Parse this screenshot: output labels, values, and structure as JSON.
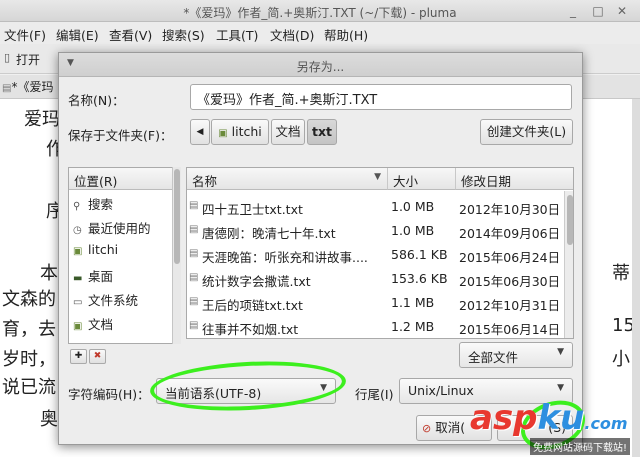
{
  "window": {
    "title": "*《爱玛》作者_简.+奥斯汀.TXT (~/下载) - pluma",
    "menu": [
      "文件(F)",
      "编辑(E)",
      "查看(V)",
      "搜索(S)",
      "工具(T)",
      "文档(D)",
      "帮助(H)"
    ],
    "toolbar_open": "打开",
    "tab_label": "*《爱玛",
    "text_fragments": [
      "爱玛",
      "作",
      "序",
      "本",
      "文森的",
      "育，去",
      "岁时，",
      "说已流",
      "奥",
      "蒂",
      "15",
      "小"
    ]
  },
  "dialog": {
    "title": "另存为...",
    "name_label": "名称(N)：",
    "filename": "《爱玛》作者_简.+奥斯汀.TXT",
    "folder_label": "保存于文件夹(F)：",
    "path": [
      "litchi",
      "文档",
      "txt"
    ],
    "create_folder": "创建文件夹(L)",
    "places_header": "位置(R)",
    "places": [
      {
        "label": "搜索",
        "icon": "search-icon"
      },
      {
        "label": "最近使用的",
        "icon": "recent-icon"
      },
      {
        "label": "litchi",
        "icon": "home-folder-icon"
      },
      {
        "label": "桌面",
        "icon": "desktop-icon"
      },
      {
        "label": "文件系统",
        "icon": "drive-icon"
      },
      {
        "label": "文档",
        "icon": "folder-icon"
      }
    ],
    "columns": {
      "name": "名称",
      "size": "大小",
      "date": "修改日期"
    },
    "files": [
      {
        "name": "四十五卫士txt.txt",
        "size": "1.0 MB",
        "date": "2012年10月30日"
      },
      {
        "name": "唐德刚：晚清七十年.txt",
        "size": "1.0 MB",
        "date": "2014年09月06日"
      },
      {
        "name": "天涯晚笛：听张充和讲故事....",
        "size": "586.1 KB",
        "date": "2015年06月24日"
      },
      {
        "name": "统计数字会撒谎.txt",
        "size": "153.6 KB",
        "date": "2015年06月30日"
      },
      {
        "name": "王后的项链txt.txt",
        "size": "1.1 MB",
        "date": "2012年10月31日"
      },
      {
        "name": "往事并不如烟.txt",
        "size": "1.2 MB",
        "date": "2015年06月14日"
      }
    ],
    "filter": "全部文件",
    "encoding_label": "字符编码(H)：",
    "encoding_value": "当前语系(UTF-8)",
    "lineend_label": "行尾(I)",
    "lineend_value": "Unix/Linux",
    "cancel": "取消(",
    "save": "(S)"
  },
  "watermark": {
    "brand_a": "asp",
    "brand_b": "ku",
    "brand_c": ".com",
    "sub": "免费网站源码下载站!"
  },
  "colors": {
    "highlight_circle": "#3cef1e",
    "watermark_red": "#e8382f",
    "watermark_blue": "#2d8fe0"
  }
}
